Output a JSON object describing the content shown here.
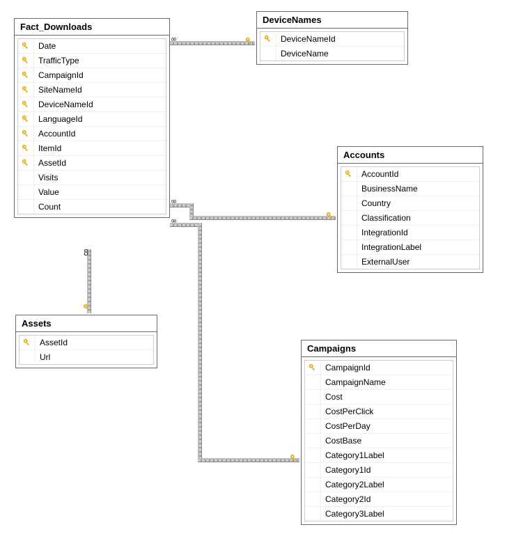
{
  "tables": {
    "fact_downloads": {
      "title": "Fact_Downloads",
      "columns": [
        {
          "name": "Date",
          "pk": true
        },
        {
          "name": "TrafficType",
          "pk": true
        },
        {
          "name": "CampaignId",
          "pk": true
        },
        {
          "name": "SiteNameId",
          "pk": true
        },
        {
          "name": "DeviceNameId",
          "pk": true
        },
        {
          "name": "LanguageId",
          "pk": true
        },
        {
          "name": "AccountId",
          "pk": true
        },
        {
          "name": "ItemId",
          "pk": true
        },
        {
          "name": "AssetId",
          "pk": true
        },
        {
          "name": "Visits",
          "pk": false
        },
        {
          "name": "Value",
          "pk": false
        },
        {
          "name": "Count",
          "pk": false
        }
      ]
    },
    "device_names": {
      "title": "DeviceNames",
      "columns": [
        {
          "name": "DeviceNameId",
          "pk": true
        },
        {
          "name": "DeviceName",
          "pk": false
        }
      ]
    },
    "accounts": {
      "title": "Accounts",
      "columns": [
        {
          "name": "AccountId",
          "pk": true
        },
        {
          "name": "BusinessName",
          "pk": false
        },
        {
          "name": "Country",
          "pk": false
        },
        {
          "name": "Classification",
          "pk": false
        },
        {
          "name": "IntegrationId",
          "pk": false
        },
        {
          "name": "IntegrationLabel",
          "pk": false
        },
        {
          "name": "ExternalUser",
          "pk": false
        }
      ]
    },
    "assets": {
      "title": "Assets",
      "columns": [
        {
          "name": "AssetId",
          "pk": true
        },
        {
          "name": "Url",
          "pk": false
        }
      ]
    },
    "campaigns": {
      "title": "Campaigns",
      "columns": [
        {
          "name": "CampaignId",
          "pk": true
        },
        {
          "name": "CampaignName",
          "pk": false
        },
        {
          "name": "Cost",
          "pk": false
        },
        {
          "name": "CostPerClick",
          "pk": false
        },
        {
          "name": "CostPerDay",
          "pk": false
        },
        {
          "name": "CostBase",
          "pk": false
        },
        {
          "name": "Category1Label",
          "pk": false
        },
        {
          "name": "Category1Id",
          "pk": false
        },
        {
          "name": "Category2Label",
          "pk": false
        },
        {
          "name": "Category2Id",
          "pk": false
        },
        {
          "name": "Category3Label",
          "pk": false
        }
      ]
    }
  },
  "key_svg": "<svg viewBox='0 0 16 16' width='12' height='12'><circle cx='5' cy='5' r='3.2' fill='#ffd84d' stroke='#b88800' stroke-width='1'/><rect x='6.5' y='6.5' width='7' height='2' fill='#ffd84d' stroke='#b88800' stroke-width='0.6' transform='rotate(45 6.5 6.5)'/><rect x='10' y='10' width='2' height='2' fill='#ffd84d' stroke='#b88800' stroke-width='0.6' transform='rotate(45 10 10)'/></svg>"
}
